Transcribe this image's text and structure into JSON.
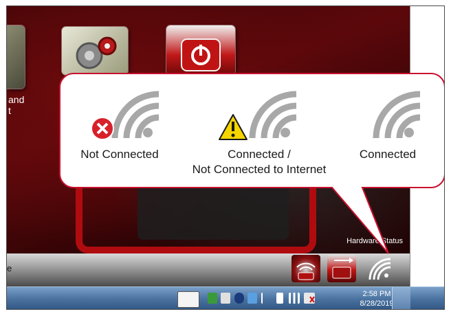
{
  "desktop": {
    "app_label_partial": "and\nt",
    "hardware_status": "Hardware Status",
    "left_edge_text": "e"
  },
  "callout": {
    "items": [
      {
        "label": "Not Connected",
        "icon": "wifi-not-connected-icon",
        "status_color": "#d8202a"
      },
      {
        "label": "Connected /\nNot Connected to Internet",
        "icon": "wifi-warning-icon",
        "status_color": "#f5d400"
      },
      {
        "label": "Connected",
        "icon": "wifi-connected-icon"
      }
    ],
    "border_color": "#c8102e"
  },
  "tray": {
    "icons": [
      "network-device-icon",
      "usb-device-icon",
      "wifi-status-icon"
    ]
  },
  "taskbar": {
    "time": "2:58 PM",
    "date": "8/28/2019",
    "icons": [
      "pen-input-icon",
      "sync-icon",
      "network-adapter-icon",
      "bluetooth-icon",
      "display-icon",
      "action-center-flag-icon",
      "battery-icon",
      "signal-bars-icon",
      "volume-muted-icon"
    ]
  }
}
